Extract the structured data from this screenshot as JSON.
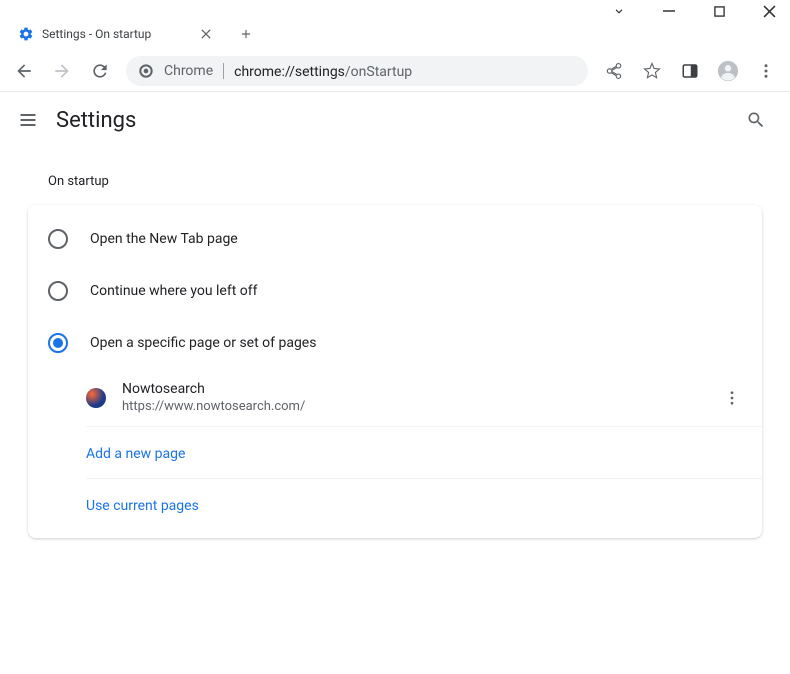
{
  "window": {
    "tab_title": "Settings - On startup"
  },
  "address": {
    "scheme_label": "Chrome",
    "host": "chrome://settings",
    "path": "/onStartup"
  },
  "header": {
    "title": "Settings"
  },
  "section": {
    "title": "On startup",
    "options": [
      {
        "label": "Open the New Tab page",
        "selected": false
      },
      {
        "label": "Continue where you left off",
        "selected": false
      },
      {
        "label": "Open a specific page or set of pages",
        "selected": true
      }
    ],
    "pages": [
      {
        "name": "Nowtosearch",
        "url": "https://www.nowtosearch.com/"
      }
    ],
    "add_page_label": "Add a new page",
    "use_current_label": "Use current pages"
  }
}
